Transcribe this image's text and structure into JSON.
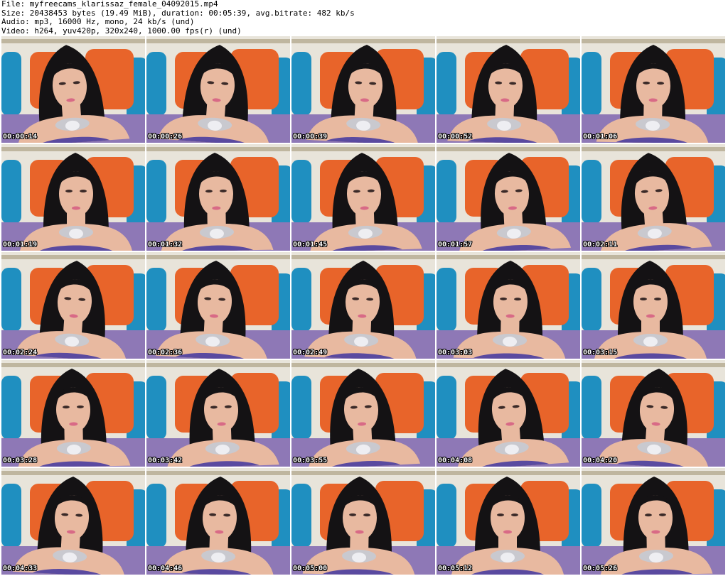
{
  "header": {
    "file_line": "File: myfreecams_klarissaz_female_04092015.mp4",
    "size_line": "Size: 20438453 bytes (19.49 MiB), duration: 00:05:39, avg.bitrate: 482 kb/s",
    "audio_line": "Audio: mp3, 16000 Hz, mono, 24 kb/s (und)",
    "video_line": "Video: h264, yuv420p, 320x240, 1000.00 fps(r) (und)"
  },
  "colors": {
    "wall": "#e8e4da",
    "pillow_orange": "#e8642a",
    "pillow_blue": "#1f8fc0",
    "sofa_purple": "#8e78b6",
    "hair": "#141214",
    "skin": "#e8b9a0",
    "necklace": "#c9c9cf",
    "top_purple": "#5a4aa0"
  },
  "thumbnails": [
    {
      "timestamp": "00:00:14"
    },
    {
      "timestamp": "00:00:26"
    },
    {
      "timestamp": "00:00:39"
    },
    {
      "timestamp": "00:00:52"
    },
    {
      "timestamp": "00:01:06"
    },
    {
      "timestamp": "00:01:19"
    },
    {
      "timestamp": "00:01:32"
    },
    {
      "timestamp": "00:01:45"
    },
    {
      "timestamp": "00:01:57"
    },
    {
      "timestamp": "00:02:11"
    },
    {
      "timestamp": "00:02:24"
    },
    {
      "timestamp": "00:02:36"
    },
    {
      "timestamp": "00:02:49"
    },
    {
      "timestamp": "00:03:03"
    },
    {
      "timestamp": "00:03:15"
    },
    {
      "timestamp": "00:03:28"
    },
    {
      "timestamp": "00:03:42"
    },
    {
      "timestamp": "00:03:55"
    },
    {
      "timestamp": "00:04:08"
    },
    {
      "timestamp": "00:04:20"
    },
    {
      "timestamp": "00:04:33"
    },
    {
      "timestamp": "00:04:46"
    },
    {
      "timestamp": "00:05:00"
    },
    {
      "timestamp": "00:05:12"
    },
    {
      "timestamp": "00:05:26"
    }
  ]
}
